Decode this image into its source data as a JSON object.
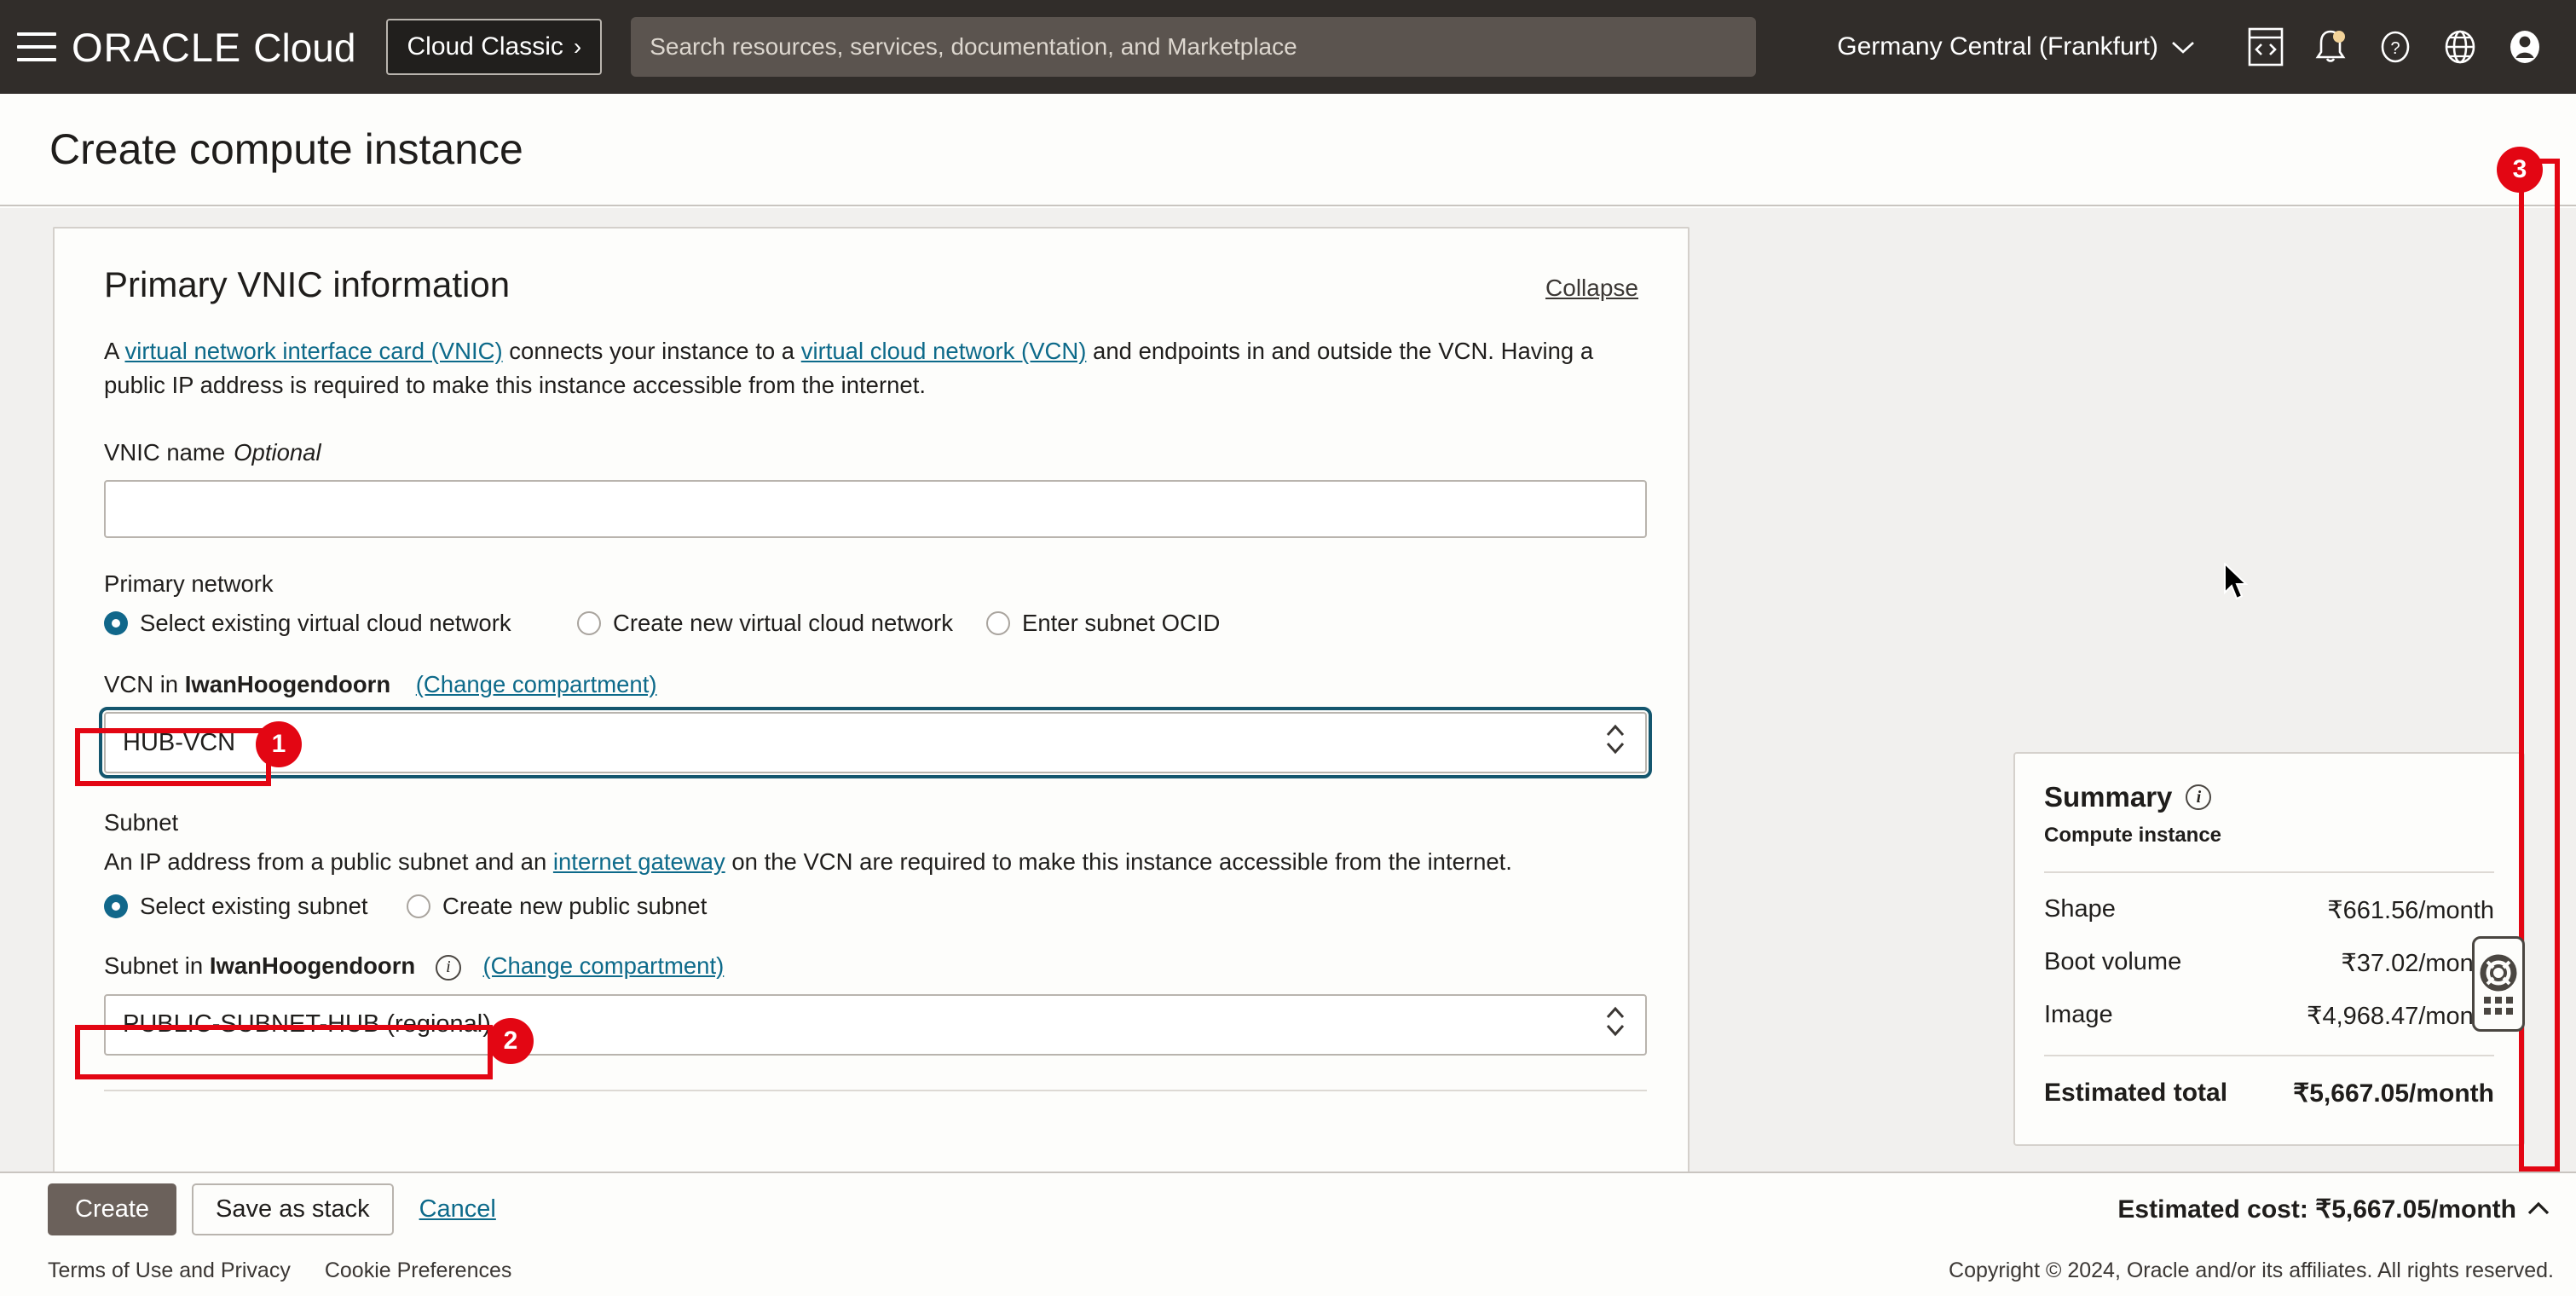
{
  "topbar": {
    "menu_icon": "hamburger-icon",
    "logo_oracle": "ORACLE",
    "logo_cloud": "Cloud",
    "cloud_classic_label": "Cloud Classic",
    "cloud_classic_chevron": "›",
    "search_placeholder": "Search resources, services, documentation, and Marketplace",
    "region": "Germany Central (Frankfurt)",
    "region_chevron": "⌄",
    "icons": [
      "cloud-shell-icon",
      "notifications-bell-icon",
      "help-question-icon",
      "language-globe-icon",
      "user-avatar-icon"
    ]
  },
  "page": {
    "title": "Create compute instance"
  },
  "card": {
    "title": "Primary VNIC information",
    "collapse_label": "Collapse",
    "desc_prefix": "A ",
    "desc_link1": "virtual network interface card (VNIC)",
    "desc_mid": " connects your instance to a ",
    "desc_link2": "virtual cloud network (VCN)",
    "desc_suffix": " and endpoints in and outside the VCN. Having a public IP address is required to make this instance accessible from the internet.",
    "vnic_name_label": "VNIC name",
    "vnic_name_optional": "Optional",
    "vnic_name_value": "",
    "primary_network_label": "Primary network",
    "primary_network_options": [
      {
        "label": "Select existing virtual cloud network",
        "selected": true
      },
      {
        "label": "Create new virtual cloud network",
        "selected": false
      },
      {
        "label": "Enter subnet OCID",
        "selected": false
      }
    ],
    "vcn_in_prefix": "VCN in ",
    "vcn_compartment": "IwanHoogendoorn",
    "vcn_change_compartment": "(Change compartment)",
    "vcn_value": "HUB-VCN",
    "subnet_label": "Subnet",
    "subnet_desc_prefix": "An IP address from a public subnet and an ",
    "subnet_desc_link": "internet gateway",
    "subnet_desc_suffix": " on the VCN are required to make this instance accessible from the internet.",
    "subnet_options": [
      {
        "label": "Select existing subnet",
        "selected": true
      },
      {
        "label": "Create new public subnet",
        "selected": false
      }
    ],
    "subnet_in_prefix": "Subnet in ",
    "subnet_compartment": "IwanHoogendoorn",
    "subnet_info_icon": "info-icon",
    "subnet_change_compartment": "(Change compartment)",
    "subnet_value": "PUBLIC-SUBNET-HUB (regional)"
  },
  "summary": {
    "title": "Summary",
    "info_icon": "info-icon",
    "subtitle": "Compute instance",
    "rows": [
      {
        "label": "Shape",
        "value": "₹661.56/month"
      },
      {
        "label": "Boot volume",
        "value": "₹37.02/month"
      },
      {
        "label": "Image",
        "value": "₹4,968.47/month"
      }
    ],
    "total_label": "Estimated total",
    "total_value": "₹5,667.05/month"
  },
  "help_widget": {
    "icon": "lifebuoy-icon",
    "grid_icon": "grid-dots-icon"
  },
  "actions": {
    "create_label": "Create",
    "save_as_stack_label": "Save as stack",
    "cancel_label": "Cancel",
    "estimated_cost": "Estimated cost: ₹5,667.05/month",
    "estimated_cost_chevron": "⌃"
  },
  "footer": {
    "terms": "Terms of Use and Privacy",
    "cookies": "Cookie Preferences",
    "copyright": "Copyright © 2024, Oracle and/or its affiliates. All rights reserved."
  },
  "annotations": {
    "color": "#e30613",
    "markers": [
      {
        "id": "1",
        "target": "vcn-select"
      },
      {
        "id": "2",
        "target": "subnet-select"
      },
      {
        "id": "3",
        "target": "page-scrollbar"
      }
    ]
  }
}
